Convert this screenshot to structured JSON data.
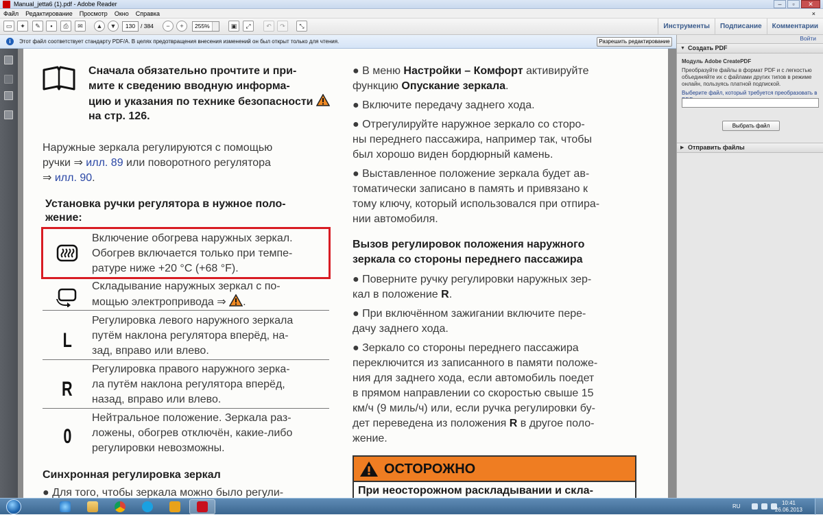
{
  "window": {
    "title": "Manual_jetta6 (1).pdf - Adobe Reader"
  },
  "menu": {
    "items": [
      "Файл",
      "Редактирование",
      "Просмотр",
      "Окно",
      "Справка"
    ],
    "close": "×"
  },
  "toolbar": {
    "page_current": "130",
    "page_total": "/ 384",
    "zoom": "255%",
    "right_links": [
      "Инструменты",
      "Подписание",
      "Комментарии"
    ]
  },
  "infobar": {
    "message": "Этот файл соответствует стандарту PDF/A. В целях предотвращения внесения изменений он был открыт только для чтения.",
    "button": "Разрешить редактирование"
  },
  "document": {
    "col1": {
      "intro_line1": "Сначала обязательно прочтите и при-",
      "intro_line2": "мите к сведению вводную информа-",
      "intro_line3": "цию и указания по технике безопасности",
      "intro_line4": "на стр. 126.",
      "p1_l1": "Наружные зеркала регулируются с помощью",
      "p1_l2a": "ручки ⇒ ",
      "p1_l2_link": "илл. 89",
      "p1_l2b": " или поворотного регулятора",
      "p1_l3a": "⇒ ",
      "p1_l3_link": "илл. 90",
      "p1_l3b": ".",
      "h1_l1": "Установка ручки регулятора в нужное поло-",
      "h1_l2": "жение:",
      "rows": [
        {
          "icon": "mirror-heating-icon",
          "l1": "Включение обогрева наружных зеркал.",
          "l2": "Обогрев включается только при темпе-",
          "l3": "ратуре ниже +20 °C (+68 °F)."
        },
        {
          "icon": "mirror-fold-icon",
          "l1": "Складывание наружных зеркал с по-",
          "l2": "мощью электропривода ⇒",
          "l3": ""
        },
        {
          "letter": "L",
          "l1": "Регулировка левого наружного зеркала",
          "l2": "путём наклона регулятора вперёд, на-",
          "l3": "зад, вправо или влево."
        },
        {
          "letter": "R",
          "l1": "Регулировка правого наружного зерка-",
          "l2": "ла путём наклона регулятора вперёд,",
          "l3": "назад, вправо или влево."
        },
        {
          "letter": "0",
          "l1": "Нейтральное положение. Зеркала раз-",
          "l2": "ложены, обогрев отключён, какие-либо",
          "l3": "регулировки невозможны."
        }
      ],
      "h2": "Синхронная регулировка зеркал",
      "last": "●  Для того, чтобы зеркала можно было регули-"
    },
    "col2": {
      "b1_l1a": "●  В меню ",
      "b1_l1b": "Настройки – Комфорт",
      "b1_l1c": " активируйте",
      "b1_l2a": "функцию ",
      "b1_l2b": "Опускание зеркала",
      "b1_l2c": ".",
      "b2": "●  Включите передачу заднего хода.",
      "b3_l1": "●  Отрегулируйте наружное зеркало со сторо-",
      "b3_l2": "ны переднего пассажира, например так, чтобы",
      "b3_l3": "был хорошо виден бордюрный камень.",
      "b4_l1": "●  Выставленное положение зеркала будет ав-",
      "b4_l2": "томатически записано в память и привязано к",
      "b4_l3": "тому ключу, который использовался при отпира-",
      "b4_l4": "нии автомобиля.",
      "h_l1": "Вызов регулировок положения наружного",
      "h_l2": "зеркала со стороны переднего пассажира",
      "c1_l1": "●  Поверните ручку регулировки наружных зер-",
      "c1_l2a": "кал в положение ",
      "c1_l2b": "R",
      "c1_l2c": ".",
      "c2_l1": "●  При включённом зажигании включите пере-",
      "c2_l2": "дачу заднего хода.",
      "c3_l1": "●  Зеркало со стороны переднего пассажира",
      "c3_l2": "переключится из записанного в памяти положе-",
      "c3_l3": "ния для заднего хода, если автомобиль поедет",
      "c3_l4": "в прямом направлении со скоростью свыше 15",
      "c3_l5": "км/ч (9 миль/ч) или, если ручка регулировки бу-",
      "c3_l6a": "дет переведена из положения ",
      "c3_l6b": "R",
      "c3_l6c": " в другое поло-",
      "c3_l7": "жение.",
      "warn_title": "ОСТОРОЖНО",
      "warn_body": "При неосторожном раскладывании и скла-"
    }
  },
  "right_panel": {
    "show": "Войти",
    "create_pdf": "Создать PDF",
    "module_title": "Модуль Adobe CreatePDF",
    "desc_l1": "Преобразуйте файлы в формат PDF и с легкостью",
    "desc_l2": "объединяйте их с файлами других типов в режиме",
    "desc_l3": "онлайн, пользуясь платной подпиской.",
    "choose_label": "Выберите файл, который требуется преобразовать в PDF:",
    "choose_button": "Выбрать файл",
    "send_files": "Отправить файлы"
  },
  "taskbar": {
    "lang": "RU",
    "time": "10:41",
    "date": "26.06.2013"
  }
}
